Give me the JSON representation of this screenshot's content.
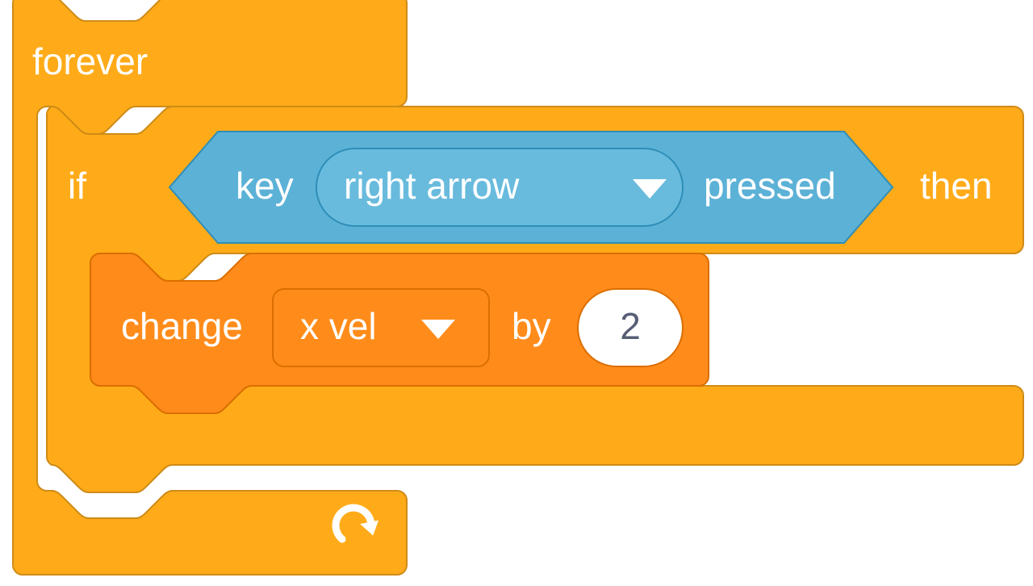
{
  "colors": {
    "control_fill": "#ffab19",
    "control_stroke": "#cf8b17",
    "sensing_fill": "#5cb1d6",
    "sensing_stroke": "#2e8eb8",
    "sensing_input_fill": "#69bbdd",
    "data_fill": "#ff8c1a",
    "data_stroke": "#db6e00",
    "data_input_fill": "#ff8c1a",
    "number_fill": "#ffffff",
    "number_text": "#575e75",
    "white": "#ffffff"
  },
  "forever": {
    "label": "forever"
  },
  "if_block": {
    "if_label": "if",
    "then_label": "then"
  },
  "key_pressed": {
    "prefix": "key",
    "suffix": "pressed",
    "selected": "right arrow"
  },
  "change_var": {
    "prefix": "change",
    "by_label": "by",
    "variable": "x vel",
    "value": "2"
  }
}
